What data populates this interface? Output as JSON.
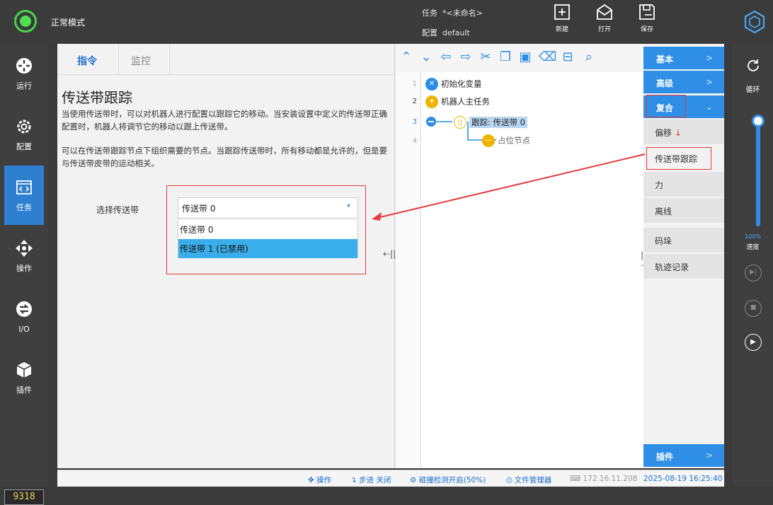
{
  "topbar": {
    "mode": "正常模式",
    "task_label": "任务",
    "task_value": "*<未命名>",
    "config_label": "配置",
    "config_value": "default",
    "buttons": [
      {
        "label": "新建",
        "icon": "new-icon"
      },
      {
        "label": "打开",
        "icon": "open-icon"
      },
      {
        "label": "保存",
        "icon": "save-icon"
      }
    ]
  },
  "leftnav": {
    "items": [
      {
        "label": "运行",
        "icon": "run-icon"
      },
      {
        "label": "配置",
        "icon": "config-icon"
      },
      {
        "label": "任务",
        "icon": "task-icon"
      },
      {
        "label": "操作",
        "icon": "move-icon"
      },
      {
        "label": "I/O",
        "icon": "io-icon"
      },
      {
        "label": "插件",
        "icon": "plugin-icon"
      }
    ],
    "active": "任务",
    "counter": "9318"
  },
  "panel": {
    "tabs": [
      "指令",
      "监控"
    ],
    "title": "传送带跟踪",
    "desc1": "当使用传送带时，可以对机器人进行配置以跟踪它的移动。当安装设置中定义的传送带正确配置时，机器人将调节它的移动以跟上传送带。",
    "desc2": "可以在传送带跟踪节点下组织需要的节点。当跟踪传送带时，所有移动都是允许的，但是要与传送带皮带的运动相关。",
    "select_label": "选择传送带",
    "select_value": "传送带 0",
    "options": [
      "传送带 0",
      "传送带 1 (已禁用)"
    ]
  },
  "tree": {
    "nodes": [
      {
        "num": "1",
        "label": "初始化变量"
      },
      {
        "num": "2",
        "label": "机器人主任务"
      },
      {
        "num": "3",
        "label": "跟踪: 传送带 0"
      },
      {
        "num": "4",
        "label": "占位节点"
      }
    ]
  },
  "rightlist": {
    "categories": [
      "基本",
      "高级",
      "复合",
      "插件"
    ],
    "sub_items": [
      "偏移",
      "传送带跟踪",
      "力",
      "离线",
      "码垛",
      "轨迹记录"
    ]
  },
  "rightbar": {
    "loop_label": "循环",
    "speed_pct": "100%",
    "speed_label": "速度",
    "speed_fraction": 1.0
  },
  "status": {
    "operate": "操作",
    "step": "步进 关闭",
    "collision": "碰撞检测开启(50%)",
    "filemgr": "文件管理器",
    "ip": "172.16.11.208",
    "datetime": "2025-08-19 16:25:40"
  },
  "colors": {
    "accent": "#2f8fe6",
    "highlight_red": "#e23b3b",
    "power_green": "#44d44a"
  }
}
